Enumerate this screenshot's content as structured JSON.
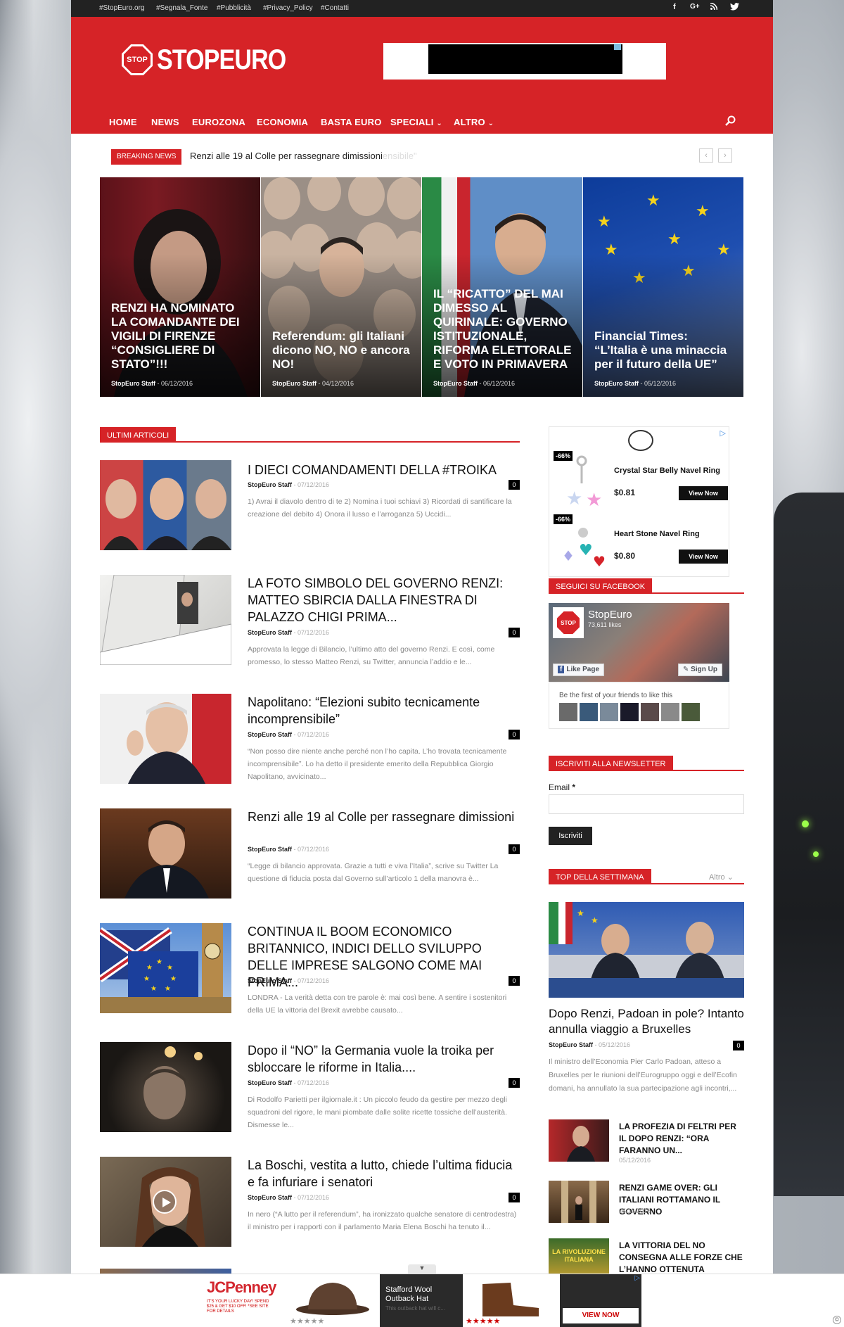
{
  "topbar": {
    "links": [
      "#StopEuro.org",
      "#Segnala_Fonte",
      "#Pubblicità",
      "#Privacy_Policy",
      "#Contatti"
    ],
    "social": [
      "f",
      "G+",
      "rss",
      "twitter"
    ]
  },
  "header": {
    "logo_text": "STOPEURO",
    "logo_sign": "STOP",
    "accent": "#d62327"
  },
  "nav": {
    "items": [
      "HOME",
      "NEWS",
      "EUROZONA",
      "ECONOMIA",
      "BASTA EURO",
      "SPECIALI",
      "ALTRO"
    ],
    "chevron": "⌄"
  },
  "breaking": {
    "label": "BREAKING NEWS",
    "text": "Renzi alle 19 al Colle per rassegnare dimissioni",
    "faded": "ensibile\""
  },
  "heroes": [
    {
      "title": "RENZI HA NOMINATO LA COMANDANTE DEI VIGILI DI FIRENZE “CONSIGLIERE DI STATO”!!!",
      "author": "StopEuro Staff",
      "date": "06/12/2016"
    },
    {
      "title": "Referendum: gli Italiani dicono NO, NO e ancora NO!",
      "author": "StopEuro Staff",
      "date": "04/12/2016"
    },
    {
      "title": "IL “RICATTO” DEL MAI DIMESSO AL QUIRINALE: GOVERNO ISTITUZIONALE, RIFORMA ELETTORALE E VOTO IN PRIMAVERA",
      "author": "StopEuro Staff",
      "date": "06/12/2016"
    },
    {
      "title": "Financial Times: “L’Italia è una minaccia per il futuro della UE”",
      "author": "StopEuro Staff",
      "date": "05/12/2016"
    }
  ],
  "latest": {
    "heading": "ULTIMI ARTICOLI",
    "articles": [
      {
        "title": "I DIECI COMANDAMENTI DELLA #TROIKA",
        "author": "StopEuro Staff",
        "date": "07/12/2016",
        "comments": "0",
        "excerpt": "1) Avrai il diavolo dentro di te 2) Nomina i tuoi schiavi 3) Ricordati di santificare la creazione del debito 4) Onora il lusso e l’arroganza 5) Uccidi..."
      },
      {
        "title": "LA FOTO SIMBOLO DEL GOVERNO RENZI: MATTEO SBIRCIA DALLA FINESTRA DI PALAZZO CHIGI PRIMA...",
        "author": "StopEuro Staff",
        "date": "07/12/2016",
        "comments": "0",
        "excerpt": "Approvata la legge di Bilancio, l’ultimo atto del governo Renzi. E così, come promesso, lo stesso Matteo Renzi, su Twitter, annuncia l’addio e le..."
      },
      {
        "title": "Napolitano: “Elezioni subito tecnicamente incomprensibile”",
        "author": "StopEuro Staff",
        "date": "07/12/2016",
        "comments": "0",
        "excerpt": "“Non posso dire niente anche perché non l’ho capita. L’ho trovata tecnicamente incomprensibile”. Lo ha detto il presidente emerito della Repubblica Giorgio Napolitano, avvicinato..."
      },
      {
        "title": "Renzi alle 19 al Colle per rassegnare dimissioni",
        "author": "StopEuro Staff",
        "date": "07/12/2016",
        "comments": "0",
        "excerpt": "“Legge di bilancio approvata. Grazie a tutti e viva l’Italia”, scrive su Twitter  La questione di fiducia posta dal Governo sull’articolo 1 della manovra è..."
      },
      {
        "title": "CONTINUA IL BOOM ECONOMICO BRITANNICO, INDICI DELLO SVILUPPO DELLE IMPRESE SALGONO COME MAI PRIMA...",
        "author": "StopEuro Staff",
        "date": "07/12/2016",
        "comments": "0",
        "excerpt": "LONDRA - La verità detta con tre parole è: mai così bene. A sentire i sostenitori della UE la vittoria del Brexit avrebbe causato..."
      },
      {
        "title": "Dopo il “NO” la Germania vuole la troika per sbloccare le riforme in Italia....",
        "author": "StopEuro Staff",
        "date": "07/12/2016",
        "comments": "0",
        "excerpt": "Di Rodolfo Parietti per ilgiornale.it : Un piccolo feudo da gestire per mezzo degli squadroni del rigore, le mani piombate dalle solite ricette tossiche dell’austerità. Dismesse le..."
      },
      {
        "title": "La Boschi, vestita a lutto, chiede l’ultima fiducia e fa infuriare i senatori",
        "author": "StopEuro Staff",
        "date": "07/12/2016",
        "comments": "0",
        "excerpt": "In nero (“A lutto per il referendum”, ha ironizzato qualche senatore di centrodestra) il ministro per i rapporti con il parlamento Maria Elena Boschi ha tenuto il..."
      }
    ]
  },
  "sidebar_ad": {
    "products": [
      {
        "discount": "-66%",
        "name": "Crystal Star Belly Navel Ring",
        "price": "$0.81",
        "button": "View Now"
      },
      {
        "discount": "-66%",
        "name": "Heart Stone Navel Ring",
        "price": "$0.80",
        "button": "View Now"
      }
    ]
  },
  "facebook": {
    "heading": "SEGUICI SU FACEBOOK",
    "page_name": "StopEuro",
    "likes": "73,611 likes",
    "like_btn": "Like Page",
    "signup_btn": "Sign Up",
    "friends_text": "Be the first of your friends to like this"
  },
  "newsletter": {
    "heading": "ISCRIVITI ALLA NEWSLETTER",
    "email_label": "Email",
    "required": "*",
    "button": "Iscriviti"
  },
  "top_week": {
    "heading": "TOP DELLA SETTIMANA",
    "more": "Altro",
    "main": {
      "title": "Dopo Renzi, Padoan in pole? Intanto annulla viaggio a Bruxelles",
      "author": "StopEuro Staff",
      "date": "05/12/2016",
      "comments": "0",
      "excerpt": "Il ministro dell’Economia Pier Carlo Padoan, atteso a Bruxelles per le riunioni dell’Eurogruppo oggi e dell’Ecofin domani, ha annullato la sua partecipazione agli incontri,..."
    },
    "items": [
      {
        "title": "LA PROFEZIA DI FELTRI PER IL DOPO RENZI: “ORA FARANNO UN...",
        "date": "05/12/2016"
      },
      {
        "title": "RENZI GAME OVER: GLI ITALIANI ROTTAMANO IL GOVERNO",
        "date": "05/12/2016"
      },
      {
        "title": "LA VITTORIA DEL NO CONSEGNA ALLE FORZE CHE L’HANNO OTTENUTA L’ONORE...",
        "thumb_text": "LA RIVOLUZIONE ITALIANA"
      }
    ]
  },
  "bottom_ad": {
    "brand": "JCPenney",
    "promo": "IT'S YOUR LUCKY DAY! SPEND $25 & GET $10 OFF! *SEE SITE FOR DETAILS",
    "product": "Stafford Wool Outback Hat",
    "product_sub": "This outback hat will c...",
    "cta": "VIEW NOW"
  }
}
